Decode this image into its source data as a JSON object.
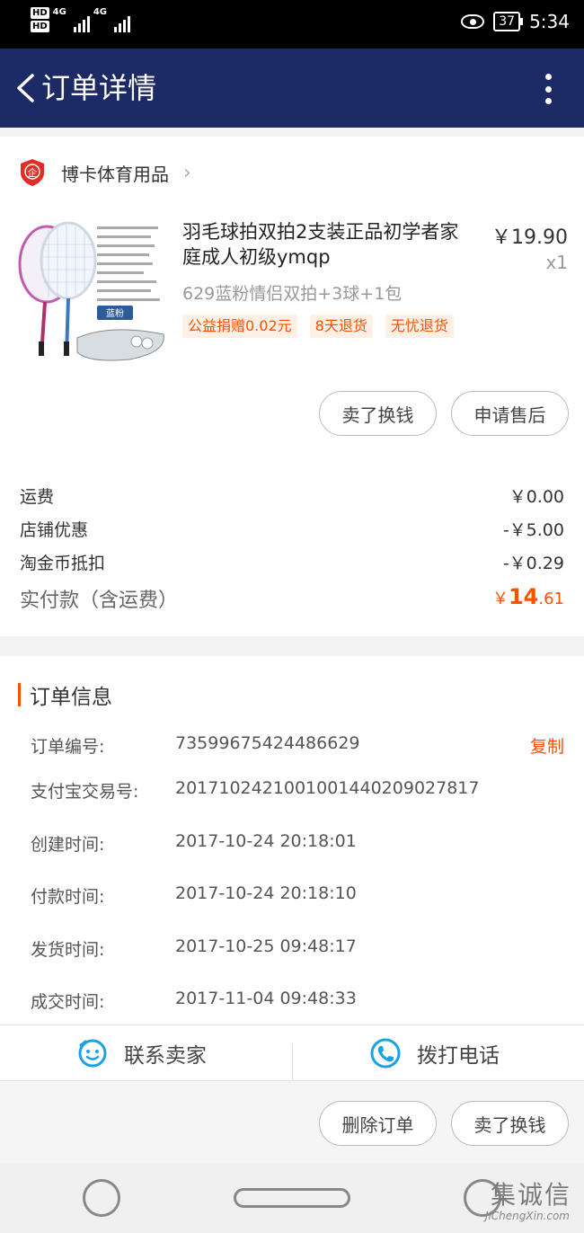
{
  "status_bar": {
    "hd1": "HD",
    "hd2": "HD",
    "net1": "4G",
    "net2": "4G",
    "battery": "37",
    "time": "5:34"
  },
  "nav": {
    "title": "订单详情"
  },
  "shop": {
    "logo_text": "企",
    "name": "博卡体育用品",
    "arrow": "›"
  },
  "product": {
    "title": "羽毛球拍双拍2支装正品初学者家庭成人初级ymqp",
    "price": "￥19.90",
    "quantity": "x1",
    "sku": "629蓝粉情侣双拍+3球+1包",
    "image_badge": "蓝粉",
    "tags": [
      "公益捐赠0.02元",
      "8天退货",
      "无忧退货"
    ]
  },
  "order_buttons": {
    "sell": "卖了换钱",
    "after_sale": "申请售后"
  },
  "fees": {
    "shipping_label": "运费",
    "shipping_value": "￥0.00",
    "shop_discount_label": "店铺优惠",
    "shop_discount_value": "-￥5.00",
    "coin_label": "淘金币抵扣",
    "coin_value": "-￥0.29",
    "total_label": "实付款（含运费）",
    "total_currency": "￥",
    "total_int": "14",
    "total_dec": ".61"
  },
  "info": {
    "title": "订单信息",
    "copy": "复制",
    "rows": [
      {
        "label": "订单编号:",
        "value": "73599675424486629"
      },
      {
        "label": "支付宝交易号:",
        "value": "2017102421001001440209027817"
      },
      {
        "label": "创建时间:",
        "value": "2017-10-24 20:18:01"
      },
      {
        "label": "付款时间:",
        "value": "2017-10-24 20:18:10"
      },
      {
        "label": "发货时间:",
        "value": "2017-10-25 09:48:17"
      },
      {
        "label": "成交时间:",
        "value": "2017-11-04 09:48:33"
      }
    ]
  },
  "actions": {
    "contact": "联系卖家",
    "call": "拨打电话"
  },
  "bottom_buttons": {
    "delete": "删除订单",
    "sell": "卖了换钱"
  },
  "watermark": {
    "cn": "集诚信",
    "en": "JiChengXin.com"
  },
  "colors": {
    "nav_bg": "#1c2a66",
    "accent": "#ff5000"
  }
}
